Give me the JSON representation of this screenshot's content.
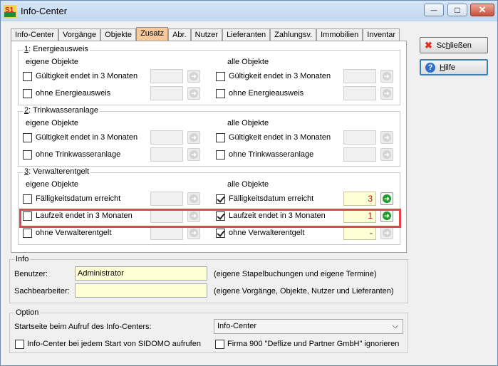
{
  "window": {
    "title": "Info-Center",
    "app_icon_text": "S1",
    "minimize_glyph": "—",
    "maximize_glyph": "□",
    "close_glyph": "✕"
  },
  "tabs": [
    {
      "label": "Info-Center"
    },
    {
      "label": "Vorgänge"
    },
    {
      "label": "Objekte"
    },
    {
      "label": "Zusatz",
      "active": true
    },
    {
      "label": "Abr."
    },
    {
      "label": "Nutzer"
    },
    {
      "label": "Lieferanten"
    },
    {
      "label": "Zahlungsv."
    },
    {
      "label": "Immobilien"
    },
    {
      "label": "Inventar"
    }
  ],
  "energie": {
    "title_num": "1",
    "title_rest": ": Energieausweis",
    "left_header": "eigene Objekte",
    "right_header": "alle Objekte",
    "row1_label": "Gültigkeit endet in 3 Monaten",
    "row2_label": "ohne Energieausweis",
    "right_row1_label": "Gültigkeit endet in 3 Monaten",
    "right_row2_label": "ohne Energieausweis"
  },
  "trinkwasser": {
    "title_num": "2",
    "title_rest": ": Trinkwasseranlage",
    "left_header": "eigene Objekte",
    "right_header": "alle Objekte",
    "row1_label": "Gültigkeit endet in 3 Monaten",
    "row2_label": "ohne Trinkwasseranlage",
    "right_row1_label": "Gültigkeit endet in 3 Monaten",
    "right_row2_label": "ohne Trinkwasseranlage"
  },
  "verwalter": {
    "title_num": "3",
    "title_rest": ": Verwalterentgelt",
    "left_header": "eigene Objekte",
    "right_header": "alle Objekte",
    "row1_label": "Fälligkeitsdatum erreicht",
    "row2_label": "Laufzeit endet in 3 Monaten",
    "row3_label": "ohne Verwalterentgelt",
    "right_row1_label": "Fälligkeitsdatum erreicht",
    "right_row2_label": "Laufzeit endet in 3 Monaten",
    "right_row3_label": "ohne Verwalterentgelt",
    "right_row1_value": "3",
    "right_row2_value": "1",
    "right_row3_value": "-"
  },
  "sidebar": {
    "close_pre": "Sc",
    "close_ul": "h",
    "close_post": "ließen",
    "help_ul": "H",
    "help_post": "ilfe"
  },
  "info": {
    "title": "Info",
    "benutzer_label": "Benutzer:",
    "benutzer_value": "Administrator",
    "benutzer_note": "(eigene Stapelbuchungen und eigene Termine)",
    "sachbearbeiter_label": "Sachbearbeiter:",
    "sachbearbeiter_value": "",
    "sachbearbeiter_note": "(eigene Vorgänge, Objekte, Nutzer und Lieferanten)"
  },
  "option": {
    "title": "Option",
    "startseite_label": "Startseite beim Aufruf des Info-Centers:",
    "startseite_value": "Info-Center",
    "checkbox1_label": "Info-Center bei jedem Start von SIDOMO aufrufen",
    "checkbox2_label": "Firma 900 \"Deflize und Partner GmbH\" ignorieren"
  },
  "colors": {
    "active_tab": "#f6c89a",
    "highlight": "#e8434b",
    "go_button": "#1e9e28",
    "input_yellow": "#ffffd5"
  }
}
